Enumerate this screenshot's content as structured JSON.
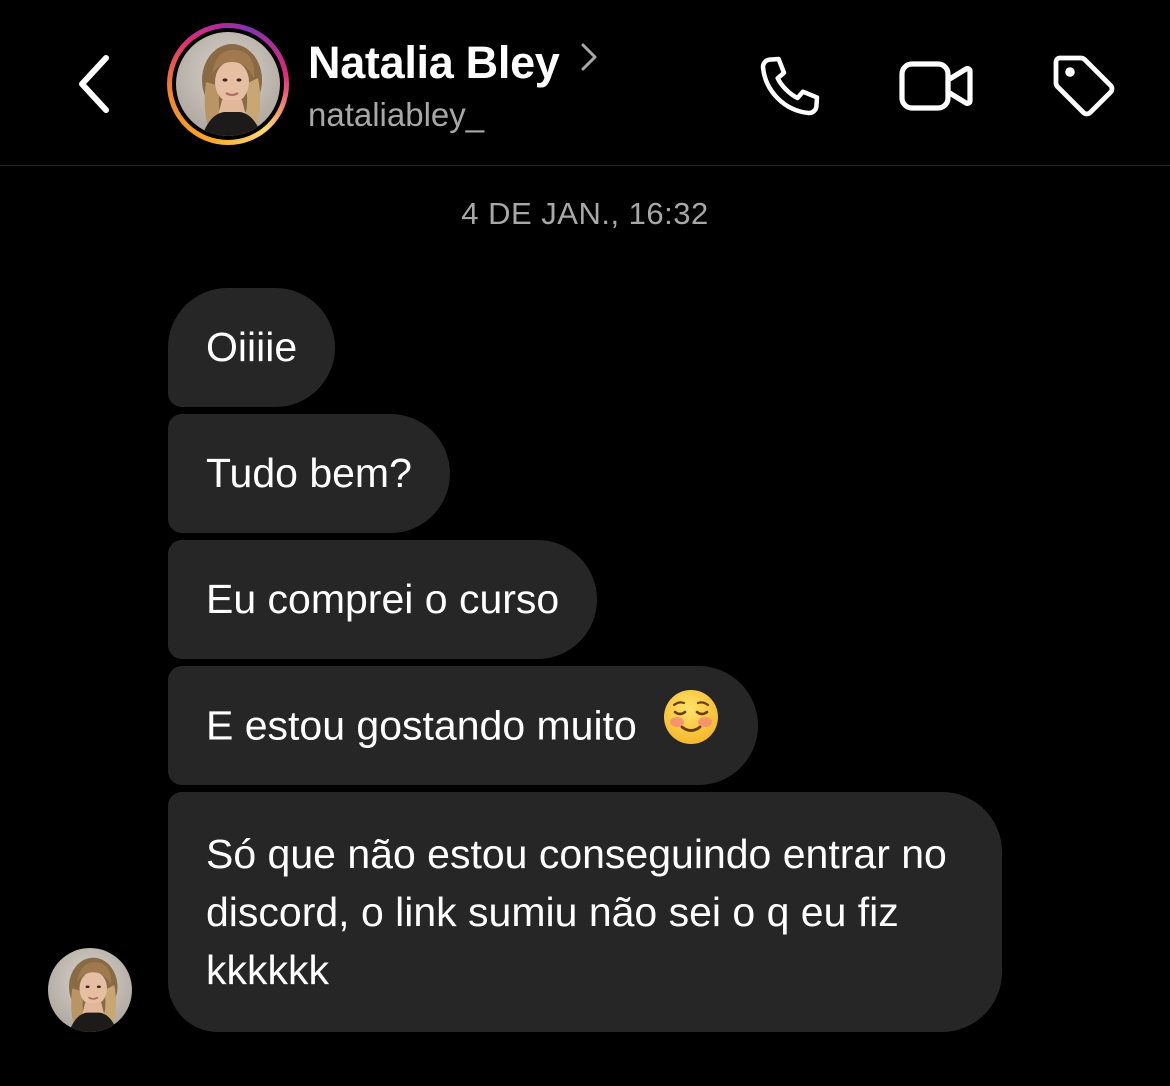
{
  "header": {
    "contact_name": "Natalia Bley",
    "username": "nataliabley_"
  },
  "icons": {
    "back": "chevron-left-icon",
    "name_chevron": "chevron-right-icon",
    "phone": "phone-icon",
    "video": "video-camera-icon",
    "tag": "tag-icon",
    "emoji": "smiling-blushing-face-emoji"
  },
  "colors": {
    "background": "#000000",
    "bubble": "#262626",
    "secondary_text": "#a8a8a8"
  },
  "thread": {
    "timestamp": "4 DE JAN., 16:32",
    "messages": [
      {
        "text": "Oiiiie"
      },
      {
        "text": "Tudo bem?"
      },
      {
        "text": "Eu comprei o curso"
      },
      {
        "text": "E estou gostando muito",
        "emoji": "☺️"
      },
      {
        "text": "Só que não estou conseguindo entrar no discord, o link sumiu não sei o q eu fiz kkkkkk"
      }
    ]
  }
}
